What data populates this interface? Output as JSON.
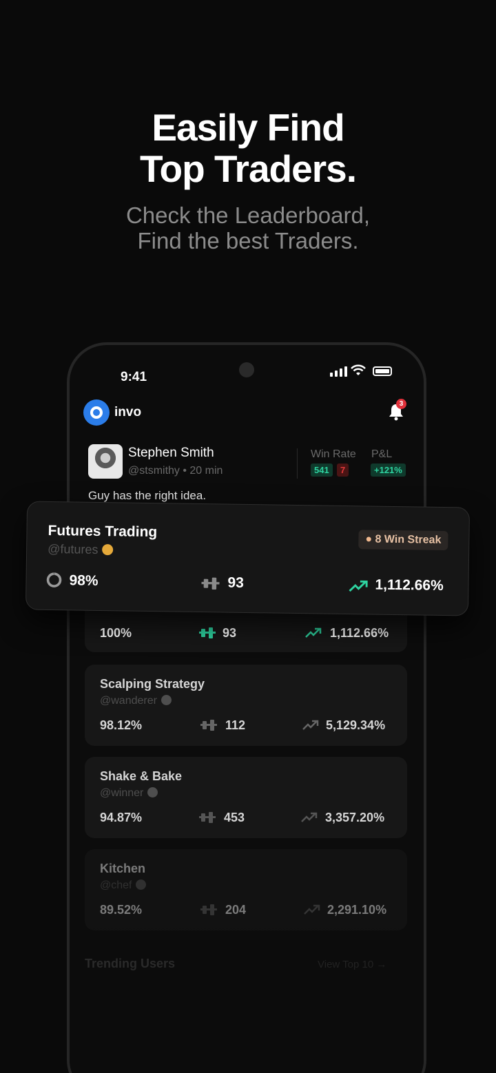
{
  "hero": {
    "line1": "Easily Find",
    "line2": "Top Traders.",
    "sub1": "Check the Leaderboard,",
    "sub2": "Find the best Traders."
  },
  "status_bar": {
    "time": "9:41"
  },
  "app": {
    "name": "invo",
    "notification_count": "3"
  },
  "post": {
    "author": "Stephen Smith",
    "meta": "@stsmithy • 20 min",
    "win_rate_label": "Win Rate",
    "pl_label": "P&L",
    "wins": "541",
    "losses": "7",
    "pl": "+121%",
    "text": "Guy has the right idea."
  },
  "featured": {
    "title": "Futures Trading",
    "handle": "@futures",
    "streak": "8 Win Streak",
    "win_rate": "98%",
    "trades": "93",
    "return": "1,112.66%"
  },
  "strategies": [
    {
      "title": "",
      "handle": "",
      "win_rate": "100%",
      "trades": "93",
      "return": "1,112.66%"
    },
    {
      "title": "Scalping Strategy",
      "handle": "@wanderer",
      "win_rate": "98.12%",
      "trades": "112",
      "return": "5,129.34%"
    },
    {
      "title": "Shake & Bake",
      "handle": "@winner",
      "win_rate": "94.87%",
      "trades": "453",
      "return": "3,357.20%"
    },
    {
      "title": "Kitchen",
      "handle": "@chef",
      "win_rate": "89.52%",
      "trades": "204",
      "return": "2,291.10%"
    }
  ],
  "trending": {
    "title": "Trending Users",
    "link": "View Top 10 →"
  },
  "colors": {
    "green": "#2ed3a0",
    "red": "#e03a3a",
    "accent": "#2b7de9"
  }
}
